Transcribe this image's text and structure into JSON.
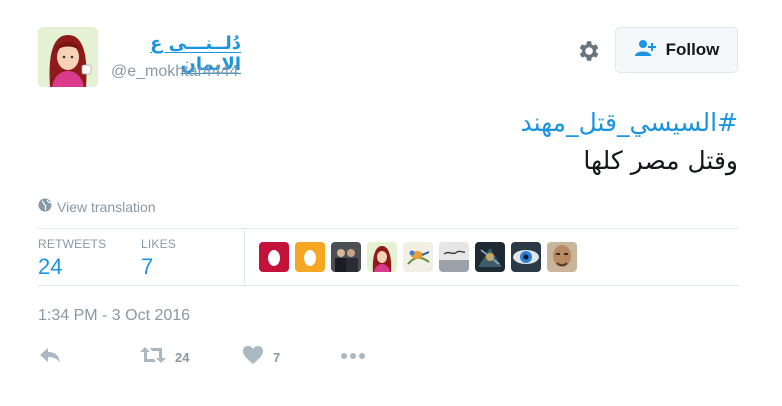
{
  "user": {
    "display_name": "دُلــنـــى ع الايمان",
    "username": "@e_mokhtar4444"
  },
  "header": {
    "follow_label": "Follow",
    "settings_icon": "gear-icon",
    "follow_icon": "add-user-icon"
  },
  "tweet": {
    "hashtag": "#السيسي_قتل_مهند",
    "line2": "وقتل مصر كلها"
  },
  "translation": {
    "label": "View translation",
    "icon": "globe-icon"
  },
  "stats": {
    "retweets_label": "RETWEETS",
    "retweets_count": "24",
    "likes_label": "LIKES",
    "likes_count": "7"
  },
  "timestamp": "1:34 PM - 3 Oct 2016",
  "actions": {
    "reply_icon": "reply-icon",
    "retweet_icon": "retweet-icon",
    "retweet_count": "24",
    "like_icon": "heart-icon",
    "like_count": "7",
    "more_icon": "more-icon"
  },
  "colors": {
    "link": "#1b95e0",
    "muted": "#8899a6",
    "border": "#e1e8ed",
    "text": "#14171a"
  }
}
